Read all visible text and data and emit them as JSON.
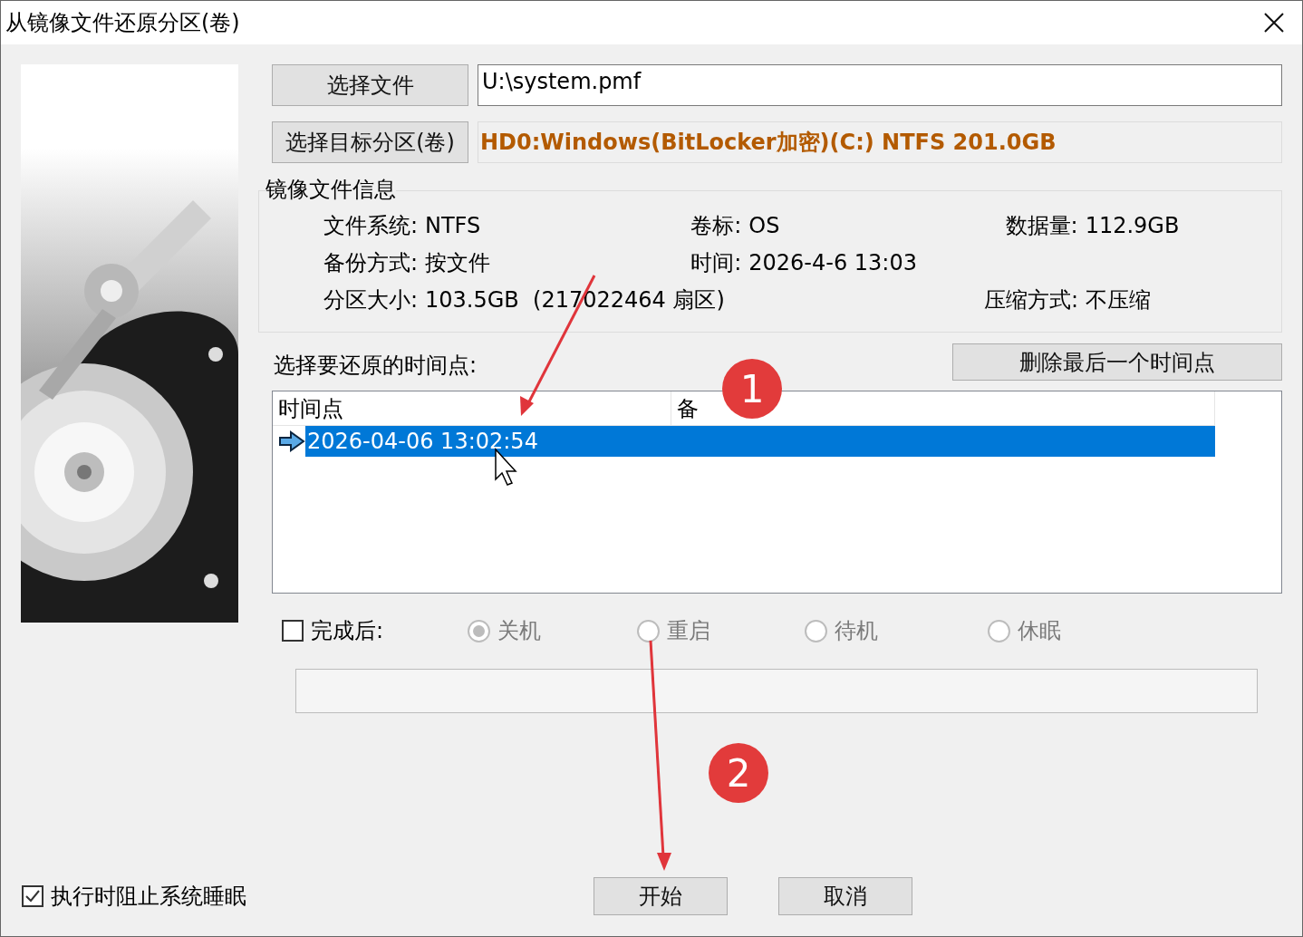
{
  "window": {
    "title": "从镜像文件还原分区(卷)"
  },
  "file": {
    "button": "选择文件",
    "value": "U:\\system.pmf"
  },
  "target": {
    "button": "选择目标分区(卷)",
    "value": "HD0:Windows(BitLocker加密)(C:) NTFS 201.0GB"
  },
  "image_info": {
    "title": "镜像文件信息",
    "rows": [
      [
        {
          "label": "文件系统:",
          "value": "NTFS"
        },
        {
          "label": "卷标:",
          "value": "OS"
        },
        {
          "label": "数据量:",
          "value": "112.9GB"
        }
      ],
      [
        {
          "label": "备份方式:",
          "value": "按文件"
        },
        {
          "label": "时间:",
          "value": "2026-4-6 13:03"
        },
        null
      ],
      [
        {
          "label": "分区大小:",
          "value": "103.5GB  (217022464 扇区)"
        },
        null,
        {
          "label": "压缩方式:",
          "value": "不压缩"
        }
      ]
    ]
  },
  "timepoints": {
    "label": "选择要还原的时间点:",
    "delete_button": "删除最后一个时间点",
    "columns": [
      "时间点",
      "备"
    ],
    "rows": [
      {
        "time": "2026-04-06 13:02:54",
        "selected": true
      }
    ]
  },
  "after_completion": {
    "label": "完成后:",
    "checked": false,
    "options": [
      {
        "label": "关机",
        "selected": true
      },
      {
        "label": "重启",
        "selected": false
      },
      {
        "label": "待机",
        "selected": false
      },
      {
        "label": "休眠",
        "selected": false
      }
    ]
  },
  "prevent_sleep": {
    "label": "执行时阻止系统睡眠",
    "checked": true
  },
  "progress": {
    "level": 0
  },
  "buttons": [
    "开始",
    "取消"
  ],
  "annotations": [
    {
      "label": "1"
    },
    {
      "label": "2"
    }
  ]
}
